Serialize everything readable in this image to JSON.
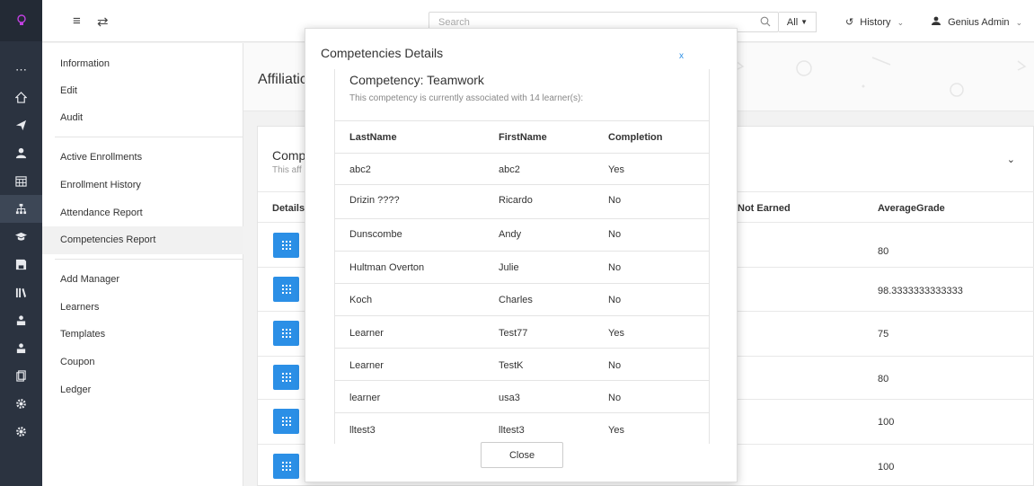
{
  "colors": {
    "accent": "#2b8fe6",
    "rail": "#2b3340",
    "logo": "#c040e0"
  },
  "rail": {
    "icons": [
      "bulb-logo-icon",
      "more-icon",
      "home-icon",
      "send-icon",
      "users-icon",
      "calendar-icon",
      "org-chart-icon",
      "graduation-icon",
      "save-icon",
      "library-icon",
      "person-icon",
      "person-icon",
      "copy-icon",
      "gear-icon",
      "gear-icon"
    ]
  },
  "topbar": {
    "search_placeholder": "Search",
    "scope_label": "All",
    "history_label": "History",
    "user_label": "Genius Admin"
  },
  "subnav": {
    "items": [
      "Information",
      "Edit",
      "Audit",
      "Active Enrollments",
      "Enrollment History",
      "Attendance Report",
      "Competencies Report",
      "Add Manager",
      "Learners",
      "Templates",
      "Coupon",
      "Ledger"
    ],
    "active": "Competencies Report"
  },
  "page": {
    "title": "Affiliatic",
    "card_title": "Comp",
    "card_subtitle": "This aff",
    "columns": [
      "Details",
      "Not Earned",
      "AverageGrade"
    ],
    "average_grades": [
      "80",
      "98.3333333333333",
      "75",
      "80",
      "100",
      "100"
    ]
  },
  "modal": {
    "title": "Competencies Details",
    "close_x": "x",
    "competency_heading": "Competency: Teamwork",
    "description": "This competency is currently associated with 14 learner(s):",
    "columns": [
      "LastName",
      "FirstName",
      "Completion"
    ],
    "rows": [
      [
        "abc2",
        "abc2",
        "Yes"
      ],
      [
        "Drizin ????",
        "Ricardo",
        "No"
      ],
      [
        "Dunscombe",
        "Andy",
        "No"
      ],
      [
        "Hultman Overton",
        "Julie",
        "No"
      ],
      [
        "Koch",
        "Charles",
        "No"
      ],
      [
        "Learner",
        "Test77",
        "Yes"
      ],
      [
        "Learner",
        "TestK",
        "No"
      ],
      [
        "learner",
        "usa3",
        "No"
      ],
      [
        "lltest3",
        "lltest3",
        "Yes"
      ]
    ],
    "close_button": "Close"
  }
}
